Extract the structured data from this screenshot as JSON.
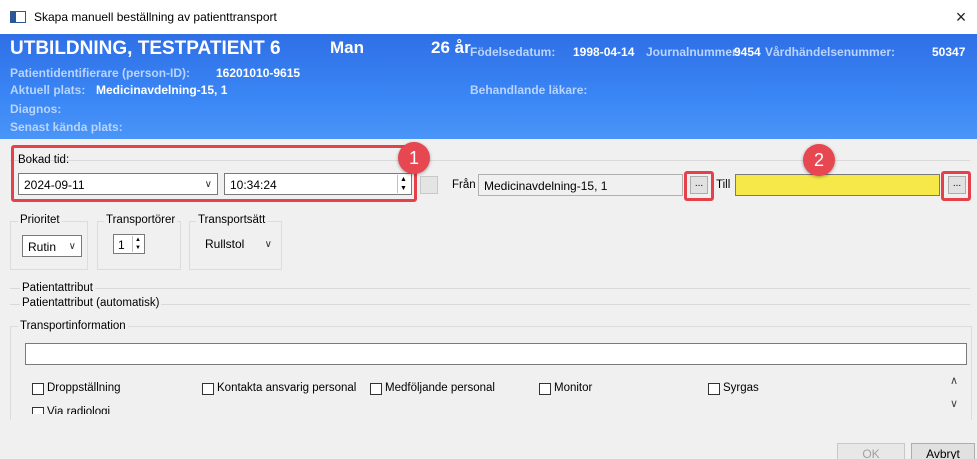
{
  "window": {
    "title": "Skapa manuell beställning av patienttransport",
    "close": "×"
  },
  "patient": {
    "name": "UTBILDNING, TESTPATIENT 6",
    "sex": "Man",
    "age": "26 år",
    "dob_label": "Födelsedatum:",
    "dob": "1998-04-14",
    "journal_label": "Journalnummer:",
    "journal": "9454",
    "episode_label": "Vårdhändelsenummer:",
    "episode": "50347",
    "id_label": "Patientidentifierare (person-ID):",
    "id": "16201010-9615",
    "location_label": "Aktuell plats:",
    "location": "Medicinavdelning-15, 1",
    "physician_label": "Behandlande läkare:",
    "diagnosis_label": "Diagnos:",
    "last_location_label": "Senast kända plats:"
  },
  "booking": {
    "label": "Bokad tid:",
    "date": "2024-09-11",
    "time": "10:34:24",
    "from_label": "Från",
    "from_value": "Medicinavdelning-15, 1",
    "to_label": "Till",
    "browse": "...",
    "badge1": "1",
    "badge2": "2"
  },
  "priority": {
    "label": "Prioritet",
    "value": "Rutin"
  },
  "transporters": {
    "label": "Transportörer",
    "value": "1"
  },
  "mode": {
    "label": "Transportsätt",
    "value": "Rullstol"
  },
  "sections": {
    "attr": "Patientattribut",
    "attr_auto": "Patientattribut (automatisk)",
    "transport_info": "Transportinformation"
  },
  "checkboxes": [
    "Droppställning",
    "Kontakta ansvarig personal",
    "Medföljande personal",
    "Monitor",
    "Syrgas",
    "Via radiologi"
  ],
  "buttons": {
    "ok": "OK",
    "cancel": "Avbryt"
  },
  "colors": {
    "header": "#3a86f5",
    "highlight": "#e4414b",
    "to_field": "#f7e84a"
  }
}
